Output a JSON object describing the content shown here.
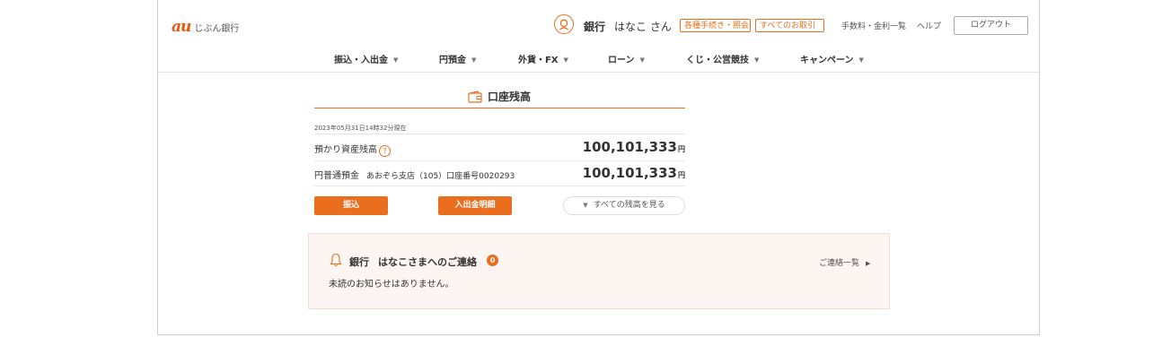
{
  "header": {
    "logo_mark": "au",
    "logo_text": "じぶん銀行",
    "user_bank": "銀行",
    "user_name": "はなこ さん",
    "pill_procedures": "各種手続き・照会",
    "pill_transactions": "すべてのお取引",
    "link_fees": "手数料・金利一覧",
    "link_help": "ヘルプ",
    "logout_label": "ログアウト"
  },
  "nav": [
    {
      "label": "振込・入出金"
    },
    {
      "label": "円預金"
    },
    {
      "label": "外貨・FX"
    },
    {
      "label": "ローン"
    },
    {
      "label": "くじ・公営競技"
    },
    {
      "label": "キャンペーン"
    }
  ],
  "balance": {
    "title": "口座残高",
    "as_of": "2023年05月31日14時32分現在",
    "total_label": "預かり資産残高",
    "total_amount": "100,101,333",
    "yen": "円",
    "account_label": "円普通預金",
    "account_detail": "あおぞら支店（105）口座番号0020293",
    "account_amount": "100,101,333",
    "transfer_button": "振込",
    "statement_button": "入出金明細",
    "see_all_label": "すべての残高を見る"
  },
  "notice": {
    "bank": "銀行",
    "title": "はなこさまへのご連絡",
    "count": "0",
    "list_link": "ご連絡一覧",
    "message": "未読のお知らせはありません。"
  },
  "colors": {
    "accent": "#eb6e1e",
    "notice_bg": "#fdf5f1"
  },
  "icons": [
    "user-avatar-icon",
    "wallet-icon",
    "help-icon",
    "bell-icon",
    "triangle-down-icon",
    "triangle-right-icon"
  ]
}
